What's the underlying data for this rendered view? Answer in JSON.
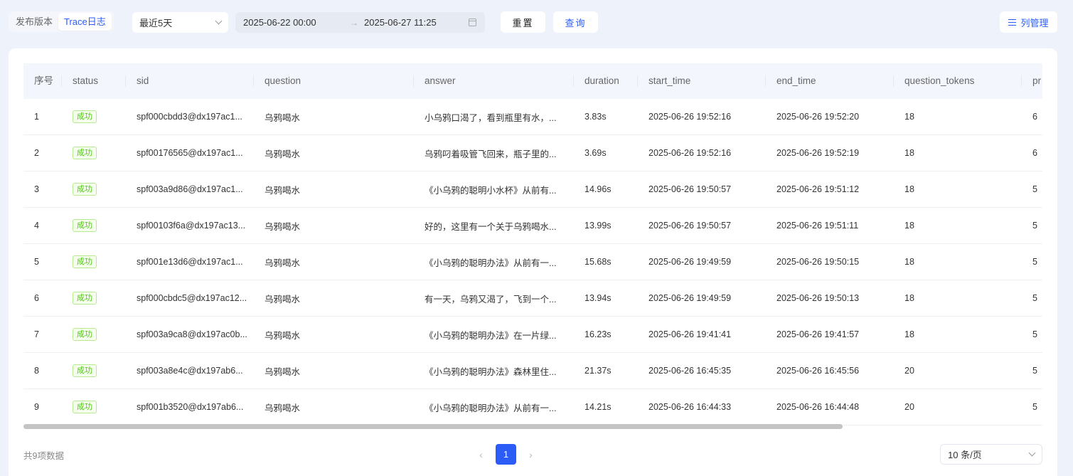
{
  "tabs": [
    {
      "label": "发布版本",
      "active": false
    },
    {
      "label": "Trace日志",
      "active": true
    }
  ],
  "range_select": {
    "value": "最近5天"
  },
  "date_range": {
    "start": "2025-06-22 00:00",
    "separator": "→",
    "end": "2025-06-27 11:25"
  },
  "buttons": {
    "reset": "重置",
    "query": "查询",
    "columns": "列管理"
  },
  "table": {
    "headers": [
      "序号",
      "status",
      "sid",
      "question",
      "answer",
      "duration",
      "start_time",
      "end_time",
      "question_tokens",
      "pr"
    ],
    "rows": [
      [
        "1",
        "成功",
        "spf000cbdd3@dx197ac1...",
        "乌鸦喝水",
        "小乌鸦口渴了，看到瓶里有水，...",
        "3.83s",
        "2025-06-26 19:52:16",
        "2025-06-26 19:52:20",
        "18",
        "6"
      ],
      [
        "2",
        "成功",
        "spf00176565@dx197ac1...",
        "乌鸦喝水",
        "乌鸦叼着吸管飞回来，瓶子里的...",
        "3.69s",
        "2025-06-26 19:52:16",
        "2025-06-26 19:52:19",
        "18",
        "6"
      ],
      [
        "3",
        "成功",
        "spf003a9d86@dx197ac1...",
        "乌鸦喝水",
        "《小乌鸦的聪明小水杯》从前有...",
        "14.96s",
        "2025-06-26 19:50:57",
        "2025-06-26 19:51:12",
        "18",
        "5"
      ],
      [
        "4",
        "成功",
        "spf00103f6a@dx197ac13...",
        "乌鸦喝水",
        "好的，这里有一个关于乌鸦喝水...",
        "13.99s",
        "2025-06-26 19:50:57",
        "2025-06-26 19:51:11",
        "18",
        "5"
      ],
      [
        "5",
        "成功",
        "spf001e13d6@dx197ac1...",
        "乌鸦喝水",
        "《小乌鸦的聪明办法》从前有一...",
        "15.68s",
        "2025-06-26 19:49:59",
        "2025-06-26 19:50:15",
        "18",
        "5"
      ],
      [
        "6",
        "成功",
        "spf000cbdc5@dx197ac12...",
        "乌鸦喝水",
        "有一天，乌鸦又渴了，飞到一个...",
        "13.94s",
        "2025-06-26 19:49:59",
        "2025-06-26 19:50:13",
        "18",
        "5"
      ],
      [
        "7",
        "成功",
        "spf003a9ca8@dx197ac0b...",
        "乌鸦喝水",
        "《小乌鸦的聪明办法》在一片绿...",
        "16.23s",
        "2025-06-26 19:41:41",
        "2025-06-26 19:41:57",
        "18",
        "5"
      ],
      [
        "8",
        "成功",
        "spf003a8e4c@dx197ab6...",
        "乌鸦喝水",
        "《小乌鸦的聪明办法》森林里住...",
        "21.37s",
        "2025-06-26 16:45:35",
        "2025-06-26 16:45:56",
        "20",
        "5"
      ],
      [
        "9",
        "成功",
        "spf001b3520@dx197ab6...",
        "乌鸦喝水",
        "《小乌鸦的聪明办法》从前有一...",
        "14.21s",
        "2025-06-26 16:44:33",
        "2025-06-26 16:44:48",
        "20",
        "5"
      ]
    ]
  },
  "footer": {
    "total": "共9项数据",
    "current_page": "1",
    "page_size": "10 条/页"
  },
  "colors": {
    "accent": "#2b5cf6",
    "success": "#52c41a",
    "background": "#eef2fb"
  }
}
